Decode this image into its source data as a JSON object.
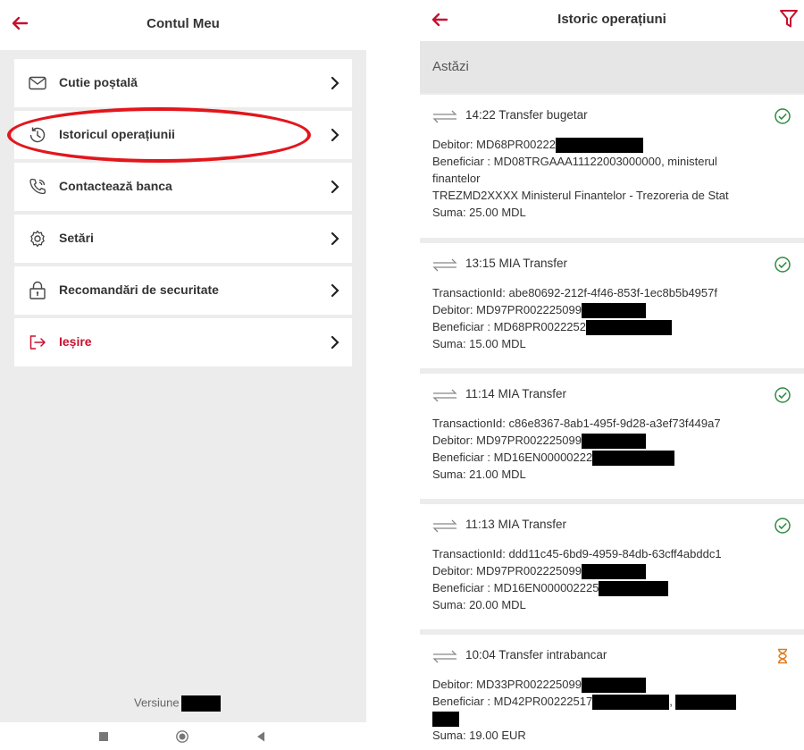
{
  "left": {
    "title": "Contul Meu",
    "back_icon": "arrow-left-icon",
    "menu": [
      {
        "label": "Cutie poștală",
        "icon": "mail-icon"
      },
      {
        "label": "Istoricul operațiunii",
        "icon": "history-icon"
      },
      {
        "label": "Contactează banca",
        "icon": "phone-icon"
      },
      {
        "label": "Setări",
        "icon": "settings-icon"
      },
      {
        "label": "Recomandări de securitate",
        "icon": "lock-icon"
      },
      {
        "label": "Ieșire",
        "icon": "logout-icon"
      }
    ],
    "version_label": "Versiune"
  },
  "right": {
    "title": "Istoric operațiuni",
    "back_icon": "arrow-left-icon",
    "filter_icon": "filter-icon",
    "section": "Astăzi",
    "transactions": [
      {
        "header": "14:22  Transfer bugetar",
        "status": "success",
        "lines": [
          "Debitor: MD68PR00222",
          "Beneficiar : MD08TRGAAA11122003000000, ministerul",
          "finantelor",
          "TREZMD2XXXX Ministerul Finantelor - Trezoreria de Stat",
          "Suma: 25.00 MDL"
        ]
      },
      {
        "header": "13:15  MIA Transfer",
        "status": "success",
        "lines": [
          "TransactionId: abe80692-212f-4f46-853f-1ec8b5b4957f",
          "Debitor: MD97PR002225099",
          "Beneficiar : MD68PR0022252",
          "Suma: 15.00 MDL"
        ]
      },
      {
        "header": "11:14  MIA Transfer",
        "status": "success",
        "lines": [
          "TransactionId: c86e8367-8ab1-495f-9d28-a3ef73f449a7",
          "Debitor: MD97PR002225099",
          "Beneficiar : MD16EN00000222",
          "Suma: 21.00 MDL"
        ]
      },
      {
        "header": "11:13  MIA Transfer",
        "status": "success",
        "lines": [
          "TransactionId: ddd11c45-6bd9-4959-84db-63cff4abddc1",
          "Debitor: MD97PR002225099",
          "Beneficiar : MD16EN000002225",
          "Suma: 20.00 MDL"
        ]
      },
      {
        "header": "10:04  Transfer intrabancar",
        "status": "pending",
        "lines": [
          "Debitor: MD33PR002225099",
          "Beneficiar : MD42PR00222517",
          "",
          "Suma: 19.00 EUR"
        ]
      }
    ]
  },
  "colors": {
    "accent_red": "#c8102e",
    "success_green": "#2e8b3e",
    "pending_orange": "#e07a1f",
    "highlight_red": "#e2161d"
  }
}
